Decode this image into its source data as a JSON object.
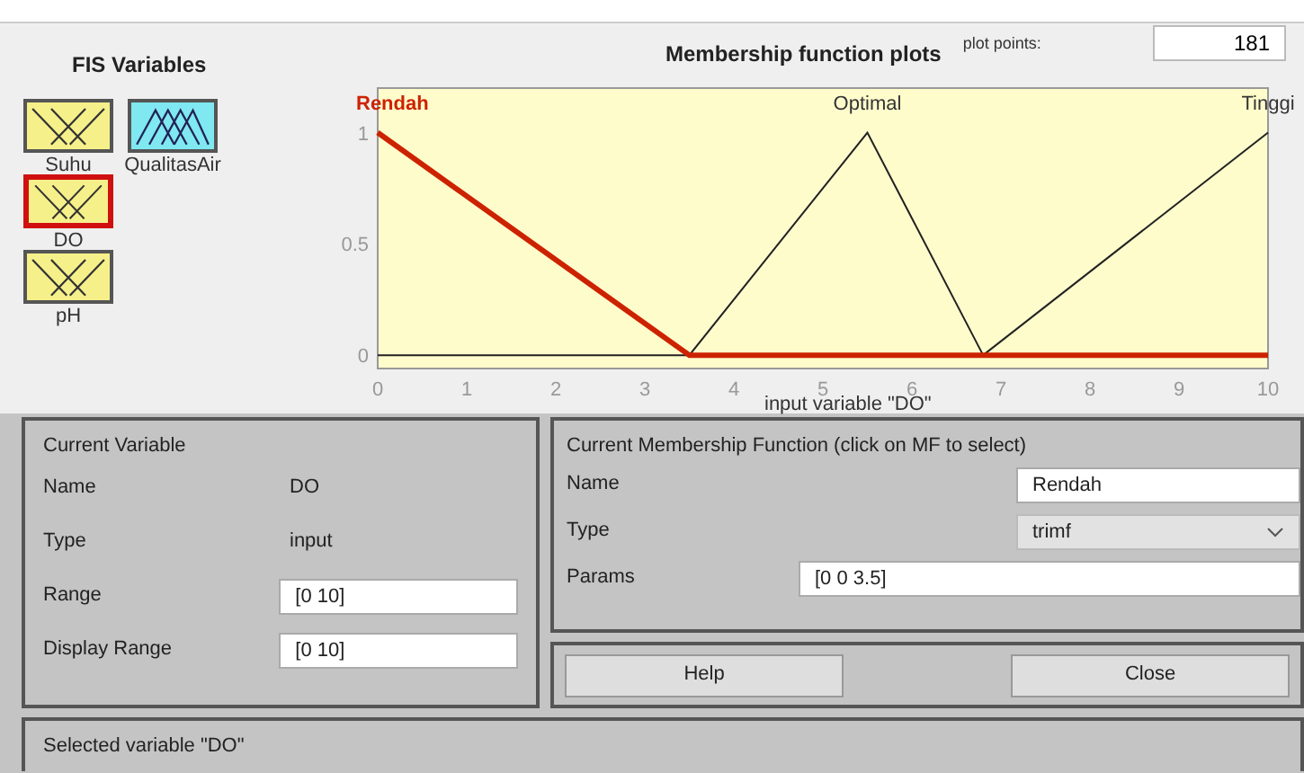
{
  "fis_variables": {
    "title": "FIS Variables",
    "items": [
      {
        "name": "Suhu",
        "kind": "input",
        "selected": false
      },
      {
        "name": "QualitasAir",
        "kind": "output",
        "selected": false
      },
      {
        "name": "DO",
        "kind": "input",
        "selected": true
      },
      {
        "name": "pH",
        "kind": "input",
        "selected": false
      }
    ]
  },
  "plot": {
    "title": "Membership function plots",
    "plot_points_label": "plot points:",
    "plot_points": "181",
    "membership_functions": [
      {
        "selected": true
      },
      {
        "selected": false
      },
      {
        "selected": false
      }
    ],
    "chart_data": {
      "type": "line",
      "xlabel": "input variable \"DO\"",
      "x": [
        0,
        3.5,
        5.5,
        6.8,
        10
      ],
      "xlim": [
        0,
        10
      ],
      "ylim": [
        -0.06,
        1.2
      ],
      "xticks": [
        0,
        1,
        2,
        3,
        4,
        5,
        6,
        7,
        8,
        9,
        10
      ],
      "yticks": [
        0,
        0.5,
        1
      ],
      "series": [
        {
          "name": "Rendah",
          "color": "#cc2200",
          "values": [
            1,
            0,
            0,
            0,
            0
          ]
        },
        {
          "name": "Optimal",
          "color": "#222222",
          "values": [
            0,
            0,
            1,
            0,
            null
          ]
        },
        {
          "name": "Tinggi",
          "color": "#222222",
          "values": [
            null,
            null,
            null,
            0,
            1
          ]
        }
      ]
    }
  },
  "current_variable": {
    "title": "Current Variable",
    "fields": [
      {
        "label": "Name",
        "value": "DO",
        "kind": "text"
      },
      {
        "label": "Type",
        "value": "input",
        "kind": "text"
      },
      {
        "label": "Range",
        "value": "[0 10]",
        "kind": "input"
      },
      {
        "label": "Display Range",
        "value": "[0 10]",
        "kind": "input"
      }
    ]
  },
  "current_mf": {
    "title": "Current Membership Function (click on MF to select)",
    "name_label": "Name",
    "name": "Rendah",
    "type_label": "Type",
    "type": "trimf",
    "params_label": "Params",
    "params": "[0 0 3.5]"
  },
  "buttons": [
    "Help",
    "Close"
  ],
  "status_bar": "Selected variable \"DO\""
}
